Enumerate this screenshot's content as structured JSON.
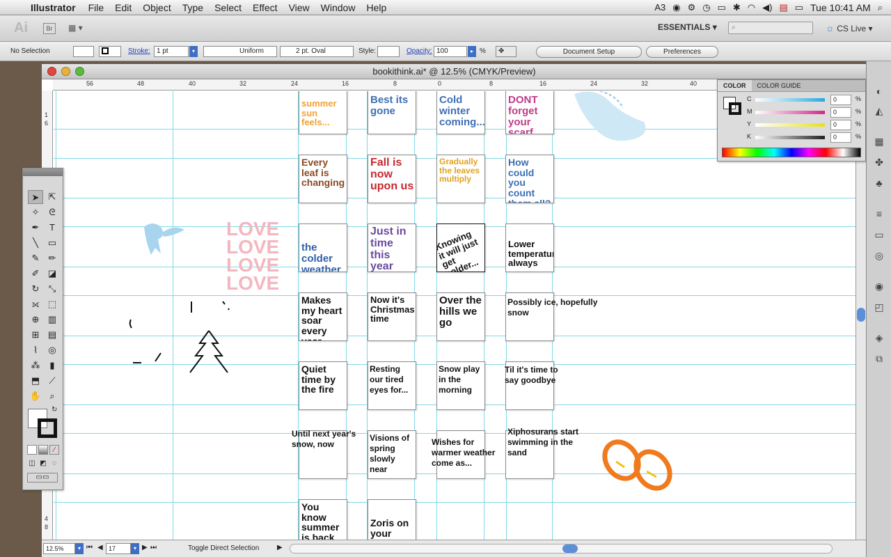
{
  "menubar": {
    "app_name": "Illustrator",
    "items": [
      "File",
      "Edit",
      "Object",
      "Type",
      "Select",
      "Effect",
      "View",
      "Window",
      "Help"
    ],
    "status": {
      "adobe_count": "3",
      "clock": "Tue 10:41 AM"
    }
  },
  "appbar": {
    "logo": "Ai",
    "bridge": "Br",
    "workspace": "ESSENTIALS",
    "search_placeholder": "",
    "cs_live": "CS Live"
  },
  "controlpanel": {
    "selection": "No Selection",
    "stroke_label": "Stroke:",
    "stroke_weight": "1 pt",
    "profile": "Uniform",
    "brush": "2 pt. Oval",
    "style_label": "Style:",
    "opacity_label": "Opacity:",
    "opacity_value": "100",
    "percent": "%",
    "document_setup": "Document Setup",
    "preferences": "Preferences"
  },
  "document": {
    "title": "bookithink.ai* @ 12.5% (CMYK/Preview)",
    "ruler_h": [
      "56",
      "48",
      "40",
      "32",
      "24",
      "16",
      "8",
      "0",
      "8",
      "16",
      "24",
      "32",
      "40"
    ],
    "ruler_v": [
      "1",
      "6",
      "4",
      "8"
    ],
    "zoom": "12.5%",
    "artboard": "17",
    "status_text": "Toggle Direct Selection"
  },
  "tiles": [
    {
      "row": 0,
      "col": 0,
      "text": "summer sun feels...",
      "color": "#f2a12f"
    },
    {
      "row": 0,
      "col": 1,
      "text": "Best its gone",
      "color": "#3d6fb5"
    },
    {
      "row": 0,
      "col": 2,
      "text": "Cold winter coming...",
      "color": "#3d6fb5"
    },
    {
      "row": 0,
      "col": 3,
      "text": "DONT forget your scarf",
      "color": "#c03b8c"
    },
    {
      "row": 1,
      "col": 0,
      "text": "Every leaf is changing",
      "color": "#8a4a22"
    },
    {
      "row": 1,
      "col": 1,
      "text": "Fall is now upon us",
      "color": "#c8272e"
    },
    {
      "row": 1,
      "col": 2,
      "text": "Gradually the leaves multiply",
      "color": "#e0a21c"
    },
    {
      "row": 1,
      "col": 3,
      "text": "How could you count them all?",
      "color": "#3d6fb5"
    },
    {
      "row": 2,
      "col": 0,
      "text": "the colder weather",
      "color": "#2f5fa8"
    },
    {
      "row": 2,
      "col": 1,
      "text": "Just in time this year",
      "color": "#6a4aa0"
    },
    {
      "row": 2,
      "col": 2,
      "text": "Knowing it will just get colder...",
      "color": "#111111"
    },
    {
      "row": 2,
      "col": 3,
      "text": "Lower temperatures always",
      "color": "#111111"
    },
    {
      "row": 3,
      "col": 0,
      "text": "Makes my heart soar every year",
      "color": "#111111"
    },
    {
      "row": 3,
      "col": 1,
      "text": "Now it's Christmas time",
      "color": "#111111"
    },
    {
      "row": 3,
      "col": 2,
      "text": "Over the hills we go",
      "color": "#111111"
    },
    {
      "row": 4,
      "col": 0,
      "text": "Quiet time by the fire",
      "color": "#111111"
    },
    {
      "row": 4,
      "col": 1,
      "text": "Resting our tired eyes for...",
      "color": "#111111"
    },
    {
      "row": 4,
      "col": 2,
      "text": "Snow play in the morning",
      "color": "#111111"
    },
    {
      "row": 5,
      "col": 1,
      "text": "Visions of spring slowly near",
      "color": "#111111"
    },
    {
      "row": 5,
      "col": 2,
      "text": "Wishes for warmer weather come as...",
      "color": "#111111"
    },
    {
      "row": 5,
      "col": 3,
      "text": "Xiphosurans start swimming in the sand",
      "color": "#111111"
    },
    {
      "row": 6,
      "col": 0,
      "text": "You know summer is back",
      "color": "#111111"
    },
    {
      "row": 6,
      "col": 1,
      "text": "Zoris on your",
      "color": "#111111"
    }
  ],
  "loose_text": {
    "possibly_ice": "Possibly ice, hopefully snow",
    "til_time": "Til it's time to say goodbye",
    "until_next": "Until next year's snow, now",
    "love": "LOVE"
  },
  "colorpanel": {
    "tab_color": "COLOR",
    "tab_guide": "COLOR GUIDE",
    "channels": [
      {
        "label": "C",
        "value": "0",
        "color": "#27a9e1"
      },
      {
        "label": "M",
        "value": "0",
        "color": "#d02a8a"
      },
      {
        "label": "Y",
        "value": "0",
        "color": "#e8e020"
      },
      {
        "label": "K",
        "value": "0",
        "color": "#222222"
      }
    ]
  }
}
